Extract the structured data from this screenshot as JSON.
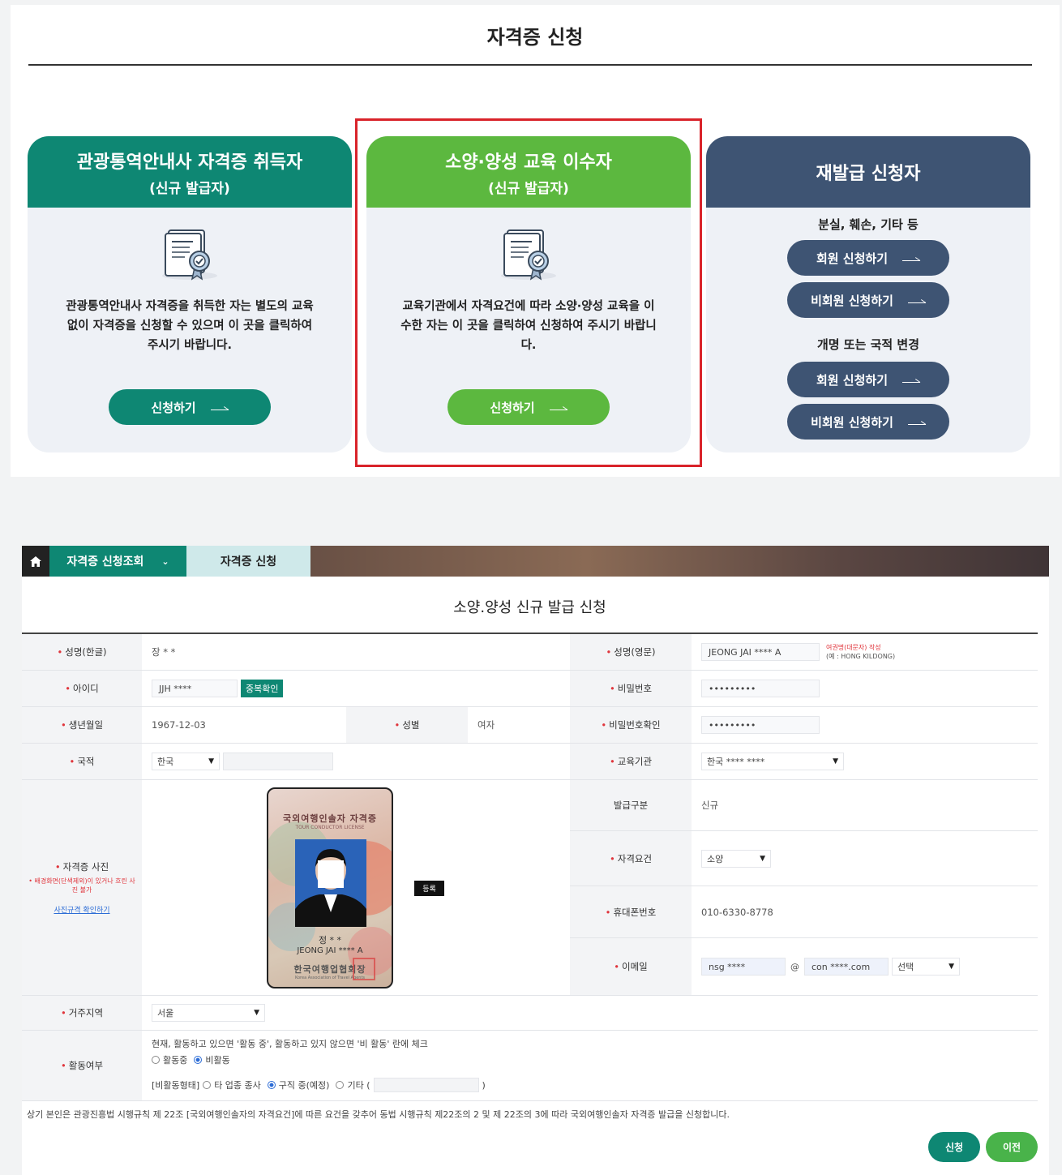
{
  "top": {
    "title": "자격증 신청",
    "cards": [
      {
        "head1": "관광통역안내사 자격증 취득자",
        "head2": "(신규 발급자)",
        "desc": "관광통역안내사 자격증을 취득한 자는 별도의 교육 없이 자격증을 신청할 수 있으며 이 곳을 클릭하여 주시기 바랍니다.",
        "button": "신청하기"
      },
      {
        "head1": "소양·양성 교육 이수자",
        "head2": "(신규 발급자)",
        "desc": "교육기관에서 자격요건에 따라 소양·양성 교육을 이수한 자는 이 곳을 클릭하여 신청하여 주시기 바랍니다.",
        "button": "신청하기"
      },
      {
        "head1": "재발급 신청자",
        "group1": "분실, 훼손, 기타 등",
        "group2": "개명 또는 국적 변경",
        "member": "회원 신청하기",
        "nonmember": "비회원 신청하기"
      }
    ]
  },
  "nav": {
    "tab1": "자격증 신청조회",
    "tab2": "자격증 신청"
  },
  "form": {
    "title": "소양.양성 신규 발급 신청",
    "name_kr_label": "성명(한글)",
    "name_kr": "장 * *",
    "name_en_label": "성명(영문)",
    "name_en": "JEONG JAI **** A",
    "name_en_hint1": "여권명(대문자) 작성",
    "name_en_hint2": "(예 : HONG KILDONG)",
    "id_label": "아이디",
    "id": "JJH ****",
    "dup_btn": "중복확인",
    "pw_label": "비밀번호",
    "pw": "•••••••••",
    "birth_label": "생년월일",
    "birth": "1967-12-03",
    "gender_label": "성별",
    "gender": "여자",
    "pw_confirm_label": "비밀번호확인",
    "pw_confirm": "•••••••••",
    "nation_label": "국적",
    "nation": "한국",
    "edu_label": "교육기관",
    "edu": "한국 **** ****",
    "issue_type_label": "발급구분",
    "issue_type": "신규",
    "photo_label": "자격증 사진",
    "photo_note": "• 배경화면(단색제외)이 있거나 흐린 사진 불가",
    "photo_link": "사진규격 확인하기",
    "photo_card_title": "국외여행인솔자 자격증",
    "photo_card_sub": "TOUR CONDUCTOR LICENSE",
    "photo_card_name": "정 * *",
    "photo_card_en": "JEONG JAI **** A",
    "photo_card_org": "한국여행업협회장",
    "photo_card_org_en": "Korea Association of Travel Agents",
    "reg_btn": "등록",
    "qual_label": "자격요건",
    "qual": "소양",
    "phone_label": "휴대폰번호",
    "phone": "010-6330-8778",
    "email_label": "이메일",
    "email_id": "nsg ****",
    "email_at": "@",
    "email_domain": "con ****.com",
    "email_select": "선택",
    "region_label": "거주지역",
    "region": "서울",
    "active_label": "활동여부",
    "active_note": "현재, 활동하고 있으면 '활동 중', 활동하고 있지 않으면 '비 활동' 란에 체크",
    "active_opt1": "활동중",
    "active_opt2": "비활동",
    "inactive_prefix": "[비활동형태]",
    "inactive_opt1": "타 업종 종사",
    "inactive_opt2": "구직 중(예정)",
    "inactive_opt3": "기타 (",
    "inactive_close": ")",
    "footnote": "상기 본인은 관광진흥법 시행규칙 제 22조 [국외여행인솔자의 자격요건]에 따른 요건을 갖추어 동법 시행규칙 제22조의 2 및 제 22조의 3에 따라 국외여행인솔자 자격증 발급을 신청합니다.",
    "submit_btn": "신청",
    "prev_btn": "이전"
  },
  "colors": {
    "teal": "#0e8773",
    "green": "#5cb83f",
    "navy": "#3e5473",
    "highlight": "#d9232a"
  }
}
